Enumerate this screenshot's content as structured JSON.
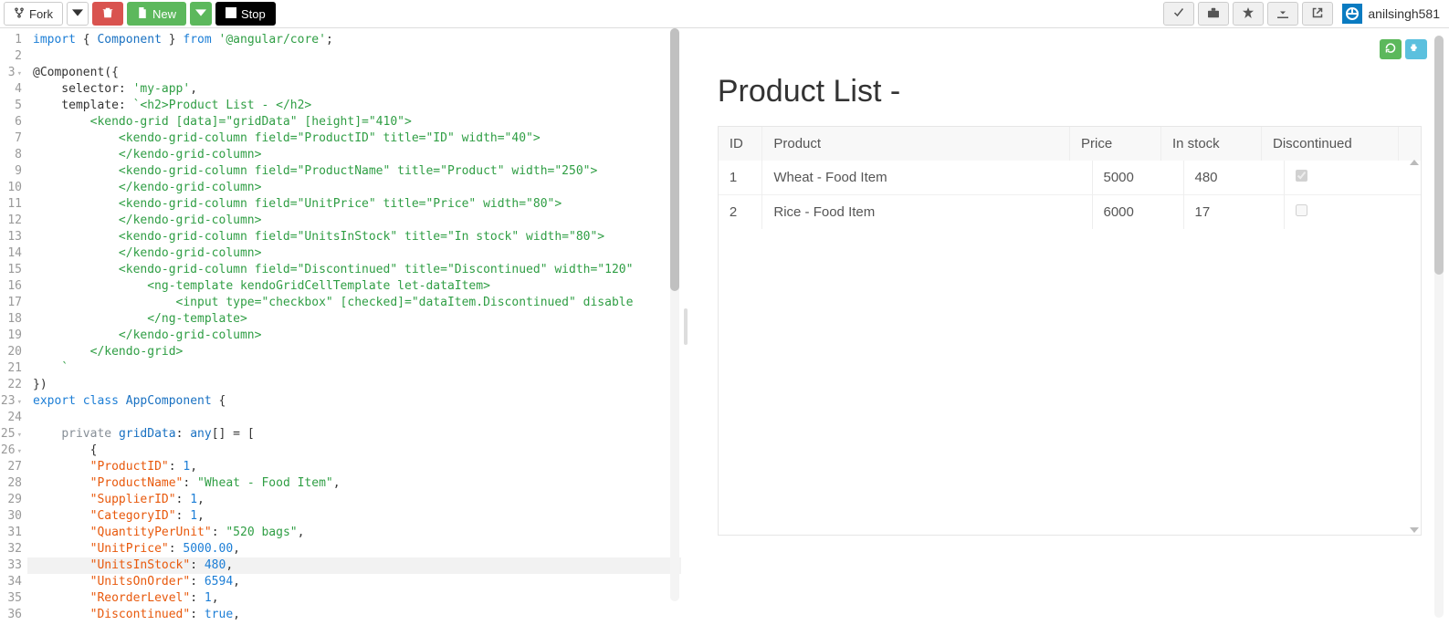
{
  "topbar": {
    "fork_label": "Fork",
    "new_label": "New",
    "stop_label": "Stop",
    "username": "anilsingh581"
  },
  "editor": {
    "line_count": 36,
    "arrow_lines": [
      3,
      23,
      25,
      26
    ],
    "highlighted_line": 33,
    "lines": [
      {
        "n": 1,
        "segs": [
          {
            "t": "import",
            "c": "tok-kw"
          },
          {
            "t": " { "
          },
          {
            "t": "Component",
            "c": "tok-var"
          },
          {
            "t": " } "
          },
          {
            "t": "from",
            "c": "tok-kw"
          },
          {
            "t": " "
          },
          {
            "t": "'@angular/core'",
            "c": "tok-str"
          },
          {
            "t": ";"
          }
        ]
      },
      {
        "n": 2,
        "segs": []
      },
      {
        "n": 3,
        "segs": [
          {
            "t": "@Component({"
          }
        ]
      },
      {
        "n": 4,
        "segs": [
          {
            "t": "    selector: "
          },
          {
            "t": "'my-app'",
            "c": "tok-str"
          },
          {
            "t": ","
          }
        ]
      },
      {
        "n": 5,
        "segs": [
          {
            "t": "    template: "
          },
          {
            "t": "`<h2>Product List - </h2>",
            "c": "tok-attr"
          }
        ]
      },
      {
        "n": 6,
        "segs": [
          {
            "t": "        <kendo-grid [data]=\"gridData\" [height]=\"410\">",
            "c": "tok-attr"
          }
        ]
      },
      {
        "n": 7,
        "segs": [
          {
            "t": "            <kendo-grid-column field=\"ProductID\" title=\"ID\" width=\"40\">",
            "c": "tok-attr"
          }
        ]
      },
      {
        "n": 8,
        "segs": [
          {
            "t": "            </kendo-grid-column>",
            "c": "tok-attr"
          }
        ]
      },
      {
        "n": 9,
        "segs": [
          {
            "t": "            <kendo-grid-column field=\"ProductName\" title=\"Product\" width=\"250\">",
            "c": "tok-attr"
          }
        ]
      },
      {
        "n": 10,
        "segs": [
          {
            "t": "            </kendo-grid-column>",
            "c": "tok-attr"
          }
        ]
      },
      {
        "n": 11,
        "segs": [
          {
            "t": "            <kendo-grid-column field=\"UnitPrice\" title=\"Price\" width=\"80\">",
            "c": "tok-attr"
          }
        ]
      },
      {
        "n": 12,
        "segs": [
          {
            "t": "            </kendo-grid-column>",
            "c": "tok-attr"
          }
        ]
      },
      {
        "n": 13,
        "segs": [
          {
            "t": "            <kendo-grid-column field=\"UnitsInStock\" title=\"In stock\" width=\"80\">",
            "c": "tok-attr"
          }
        ]
      },
      {
        "n": 14,
        "segs": [
          {
            "t": "            </kendo-grid-column>",
            "c": "tok-attr"
          }
        ]
      },
      {
        "n": 15,
        "segs": [
          {
            "t": "            <kendo-grid-column field=\"Discontinued\" title=\"Discontinued\" width=\"120\"",
            "c": "tok-attr"
          }
        ]
      },
      {
        "n": 16,
        "segs": [
          {
            "t": "                <ng-template kendoGridCellTemplate let-dataItem>",
            "c": "tok-attr"
          }
        ]
      },
      {
        "n": 17,
        "segs": [
          {
            "t": "                    <input type=\"checkbox\" [checked]=\"dataItem.Discontinued\" disable",
            "c": "tok-attr"
          }
        ]
      },
      {
        "n": 18,
        "segs": [
          {
            "t": "                </ng-template>",
            "c": "tok-attr"
          }
        ]
      },
      {
        "n": 19,
        "segs": [
          {
            "t": "            </kendo-grid-column>",
            "c": "tok-attr"
          }
        ]
      },
      {
        "n": 20,
        "segs": [
          {
            "t": "        </kendo-grid>",
            "c": "tok-attr"
          }
        ]
      },
      {
        "n": 21,
        "segs": [
          {
            "t": "    `",
            "c": "tok-attr"
          }
        ]
      },
      {
        "n": 22,
        "segs": [
          {
            "t": "})"
          }
        ]
      },
      {
        "n": 23,
        "segs": [
          {
            "t": "export",
            "c": "tok-kw"
          },
          {
            "t": " "
          },
          {
            "t": "class",
            "c": "tok-kw"
          },
          {
            "t": " "
          },
          {
            "t": "AppComponent",
            "c": "tok-var"
          },
          {
            "t": " {"
          }
        ]
      },
      {
        "n": 24,
        "segs": []
      },
      {
        "n": 25,
        "segs": [
          {
            "t": "    "
          },
          {
            "t": "private",
            "c": "tok-priv"
          },
          {
            "t": " "
          },
          {
            "t": "gridData",
            "c": "tok-var"
          },
          {
            "t": ": "
          },
          {
            "t": "any",
            "c": "tok-var"
          },
          {
            "t": "[] = ["
          }
        ]
      },
      {
        "n": 26,
        "segs": [
          {
            "t": "        {"
          }
        ]
      },
      {
        "n": 27,
        "segs": [
          {
            "t": "        "
          },
          {
            "t": "\"ProductID\"",
            "c": "tok-key"
          },
          {
            "t": ": "
          },
          {
            "t": "1",
            "c": "tok-num"
          },
          {
            "t": ","
          }
        ]
      },
      {
        "n": 28,
        "segs": [
          {
            "t": "        "
          },
          {
            "t": "\"ProductName\"",
            "c": "tok-key"
          },
          {
            "t": ": "
          },
          {
            "t": "\"Wheat - Food Item\"",
            "c": "tok-str"
          },
          {
            "t": ","
          }
        ]
      },
      {
        "n": 29,
        "segs": [
          {
            "t": "        "
          },
          {
            "t": "\"SupplierID\"",
            "c": "tok-key"
          },
          {
            "t": ": "
          },
          {
            "t": "1",
            "c": "tok-num"
          },
          {
            "t": ","
          }
        ]
      },
      {
        "n": 30,
        "segs": [
          {
            "t": "        "
          },
          {
            "t": "\"CategoryID\"",
            "c": "tok-key"
          },
          {
            "t": ": "
          },
          {
            "t": "1",
            "c": "tok-num"
          },
          {
            "t": ","
          }
        ]
      },
      {
        "n": 31,
        "segs": [
          {
            "t": "        "
          },
          {
            "t": "\"QuantityPerUnit\"",
            "c": "tok-key"
          },
          {
            "t": ": "
          },
          {
            "t": "\"520 bags\"",
            "c": "tok-str"
          },
          {
            "t": ","
          }
        ]
      },
      {
        "n": 32,
        "segs": [
          {
            "t": "        "
          },
          {
            "t": "\"UnitPrice\"",
            "c": "tok-key"
          },
          {
            "t": ": "
          },
          {
            "t": "5000.00",
            "c": "tok-num"
          },
          {
            "t": ","
          }
        ]
      },
      {
        "n": 33,
        "segs": [
          {
            "t": "        "
          },
          {
            "t": "\"UnitsInStock\"",
            "c": "tok-key"
          },
          {
            "t": ": "
          },
          {
            "t": "480",
            "c": "tok-num"
          },
          {
            "t": ","
          }
        ]
      },
      {
        "n": 34,
        "segs": [
          {
            "t": "        "
          },
          {
            "t": "\"UnitsOnOrder\"",
            "c": "tok-key"
          },
          {
            "t": ": "
          },
          {
            "t": "6594",
            "c": "tok-num"
          },
          {
            "t": ","
          }
        ]
      },
      {
        "n": 35,
        "segs": [
          {
            "t": "        "
          },
          {
            "t": "\"ReorderLevel\"",
            "c": "tok-key"
          },
          {
            "t": ": "
          },
          {
            "t": "1",
            "c": "tok-num"
          },
          {
            "t": ","
          }
        ]
      },
      {
        "n": 36,
        "segs": [
          {
            "t": "        "
          },
          {
            "t": "\"Discontinued\"",
            "c": "tok-key"
          },
          {
            "t": ": "
          },
          {
            "t": "true",
            "c": "tok-bool"
          },
          {
            "t": ","
          }
        ]
      }
    ]
  },
  "preview": {
    "title": "Product List -",
    "columns": [
      "ID",
      "Product",
      "Price",
      "In stock",
      "Discontinued"
    ],
    "rows": [
      {
        "ID": "1",
        "Product": "Wheat - Food Item",
        "Price": "5000",
        "InStock": "480",
        "Discontinued": true
      },
      {
        "ID": "2",
        "Product": "Rice - Food Item",
        "Price": "6000",
        "InStock": "17",
        "Discontinued": false
      }
    ]
  }
}
